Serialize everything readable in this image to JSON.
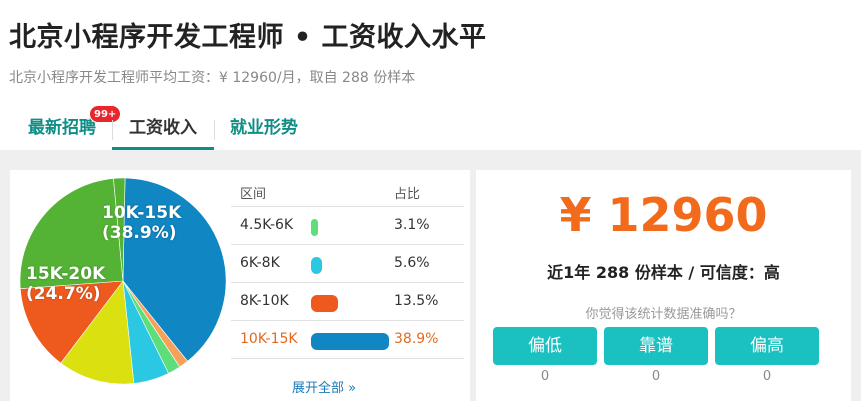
{
  "header": {
    "title": "北京小程序开发工程师 • 工资收入水平",
    "subtitle": "北京小程序开发工程师平均工资：¥ 12960/月，取自 288 份样本"
  },
  "tabs": [
    {
      "label": "最新招聘",
      "badge": "99+"
    },
    {
      "label": "工资收入",
      "active": true
    },
    {
      "label": "就业形势"
    }
  ],
  "chart_data": {
    "type": "pie",
    "slices": [
      {
        "name": "10K-15K",
        "value": 38.9,
        "color": "#1086c3",
        "label": "10K-15K\n(38.9%)"
      },
      {
        "name": "",
        "value": 1.5,
        "color": "#f7a05a"
      },
      {
        "name": "",
        "value": 2.0,
        "color": "#5ede7a"
      },
      {
        "name": "6K-8K",
        "value": 5.6,
        "color": "#2ac8e2"
      },
      {
        "name": "",
        "value": 12.0,
        "color": "#dbe011"
      },
      {
        "name": "8K-10K",
        "value": 13.5,
        "color": "#ee5a1e"
      },
      {
        "name": "15K-20K",
        "value": 24.7,
        "color": "#54b335",
        "label": "15K-20K\n(24.7%)"
      },
      {
        "name": "4.5K-6K",
        "value": 1.8,
        "color": "#54b335"
      }
    ],
    "visible_labels": [
      {
        "line1": "10K-15K",
        "line2": "(38.9%)"
      },
      {
        "line1": "15K-20K",
        "line2": "(24.7%)"
      }
    ]
  },
  "table": {
    "col_range": "区间",
    "col_ratio": "占比",
    "rows": [
      {
        "range": "4.5K-6K",
        "ratio": "3.1%",
        "fraction": 0.031,
        "color": "#5ede7a"
      },
      {
        "range": "6K-8K",
        "ratio": "5.6%",
        "fraction": 0.056,
        "color": "#2ac8e2"
      },
      {
        "range": "8K-10K",
        "ratio": "13.5%",
        "fraction": 0.135,
        "color": "#ee5a1e"
      },
      {
        "range": "10K-15K",
        "ratio": "38.9%",
        "fraction": 0.389,
        "color": "#1086c3",
        "active": true
      }
    ],
    "expand_label": "展开全部 »"
  },
  "summary": {
    "salary": "¥ 12960",
    "info": "近1年 288 份样本 / 可信度：高",
    "question": "你觉得该统计数据准确吗？"
  },
  "votes": [
    {
      "label": "偏低",
      "count": "0"
    },
    {
      "label": "靠谱",
      "count": "0"
    },
    {
      "label": "偏高",
      "count": "0"
    }
  ],
  "colors": {
    "accent": "#0f8e85",
    "salary": "#f26a1b",
    "vote_button": "#1bc1c1",
    "badge": "#e8262b"
  }
}
